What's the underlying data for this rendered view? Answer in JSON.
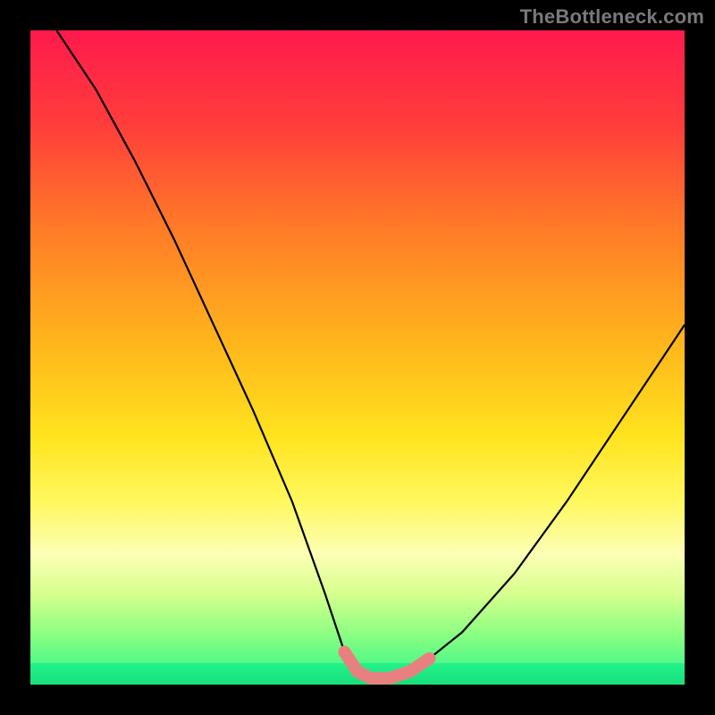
{
  "watermark": {
    "text": "TheBottleneck.com"
  },
  "chart_data": {
    "type": "line",
    "title": "",
    "xlabel": "",
    "ylabel": "",
    "xlim": [
      0,
      100
    ],
    "ylim": [
      0,
      100
    ],
    "grid": false,
    "legend": false,
    "series": [
      {
        "name": "bottleneck-curve",
        "color": "#000000",
        "x": [
          4,
          10,
          16,
          22,
          28,
          34,
          40,
          45,
          48,
          50,
          52,
          55,
          58,
          61,
          66,
          74,
          82,
          90,
          98,
          100
        ],
        "y": [
          100,
          91,
          80,
          68,
          55,
          42,
          28,
          14,
          5,
          2,
          1,
          1,
          2,
          4,
          8,
          17,
          28,
          40,
          52,
          55
        ]
      },
      {
        "name": "sweet-spot-marker",
        "color": "#e98080",
        "x": [
          48,
          50,
          52,
          55,
          58,
          61
        ],
        "y": [
          5,
          2,
          1,
          1,
          2,
          4
        ]
      }
    ],
    "background_gradient_stops": [
      {
        "pos": 0,
        "color": "#ff1a4d"
      },
      {
        "pos": 15,
        "color": "#ff3f3a"
      },
      {
        "pos": 30,
        "color": "#ff7a28"
      },
      {
        "pos": 48,
        "color": "#ffb61c"
      },
      {
        "pos": 62,
        "color": "#ffe31e"
      },
      {
        "pos": 72,
        "color": "#fff85e"
      },
      {
        "pos": 80,
        "color": "#fcffb5"
      },
      {
        "pos": 86,
        "color": "#d7ff8e"
      },
      {
        "pos": 92,
        "color": "#8fff82"
      },
      {
        "pos": 100,
        "color": "#2bf58a"
      }
    ]
  }
}
